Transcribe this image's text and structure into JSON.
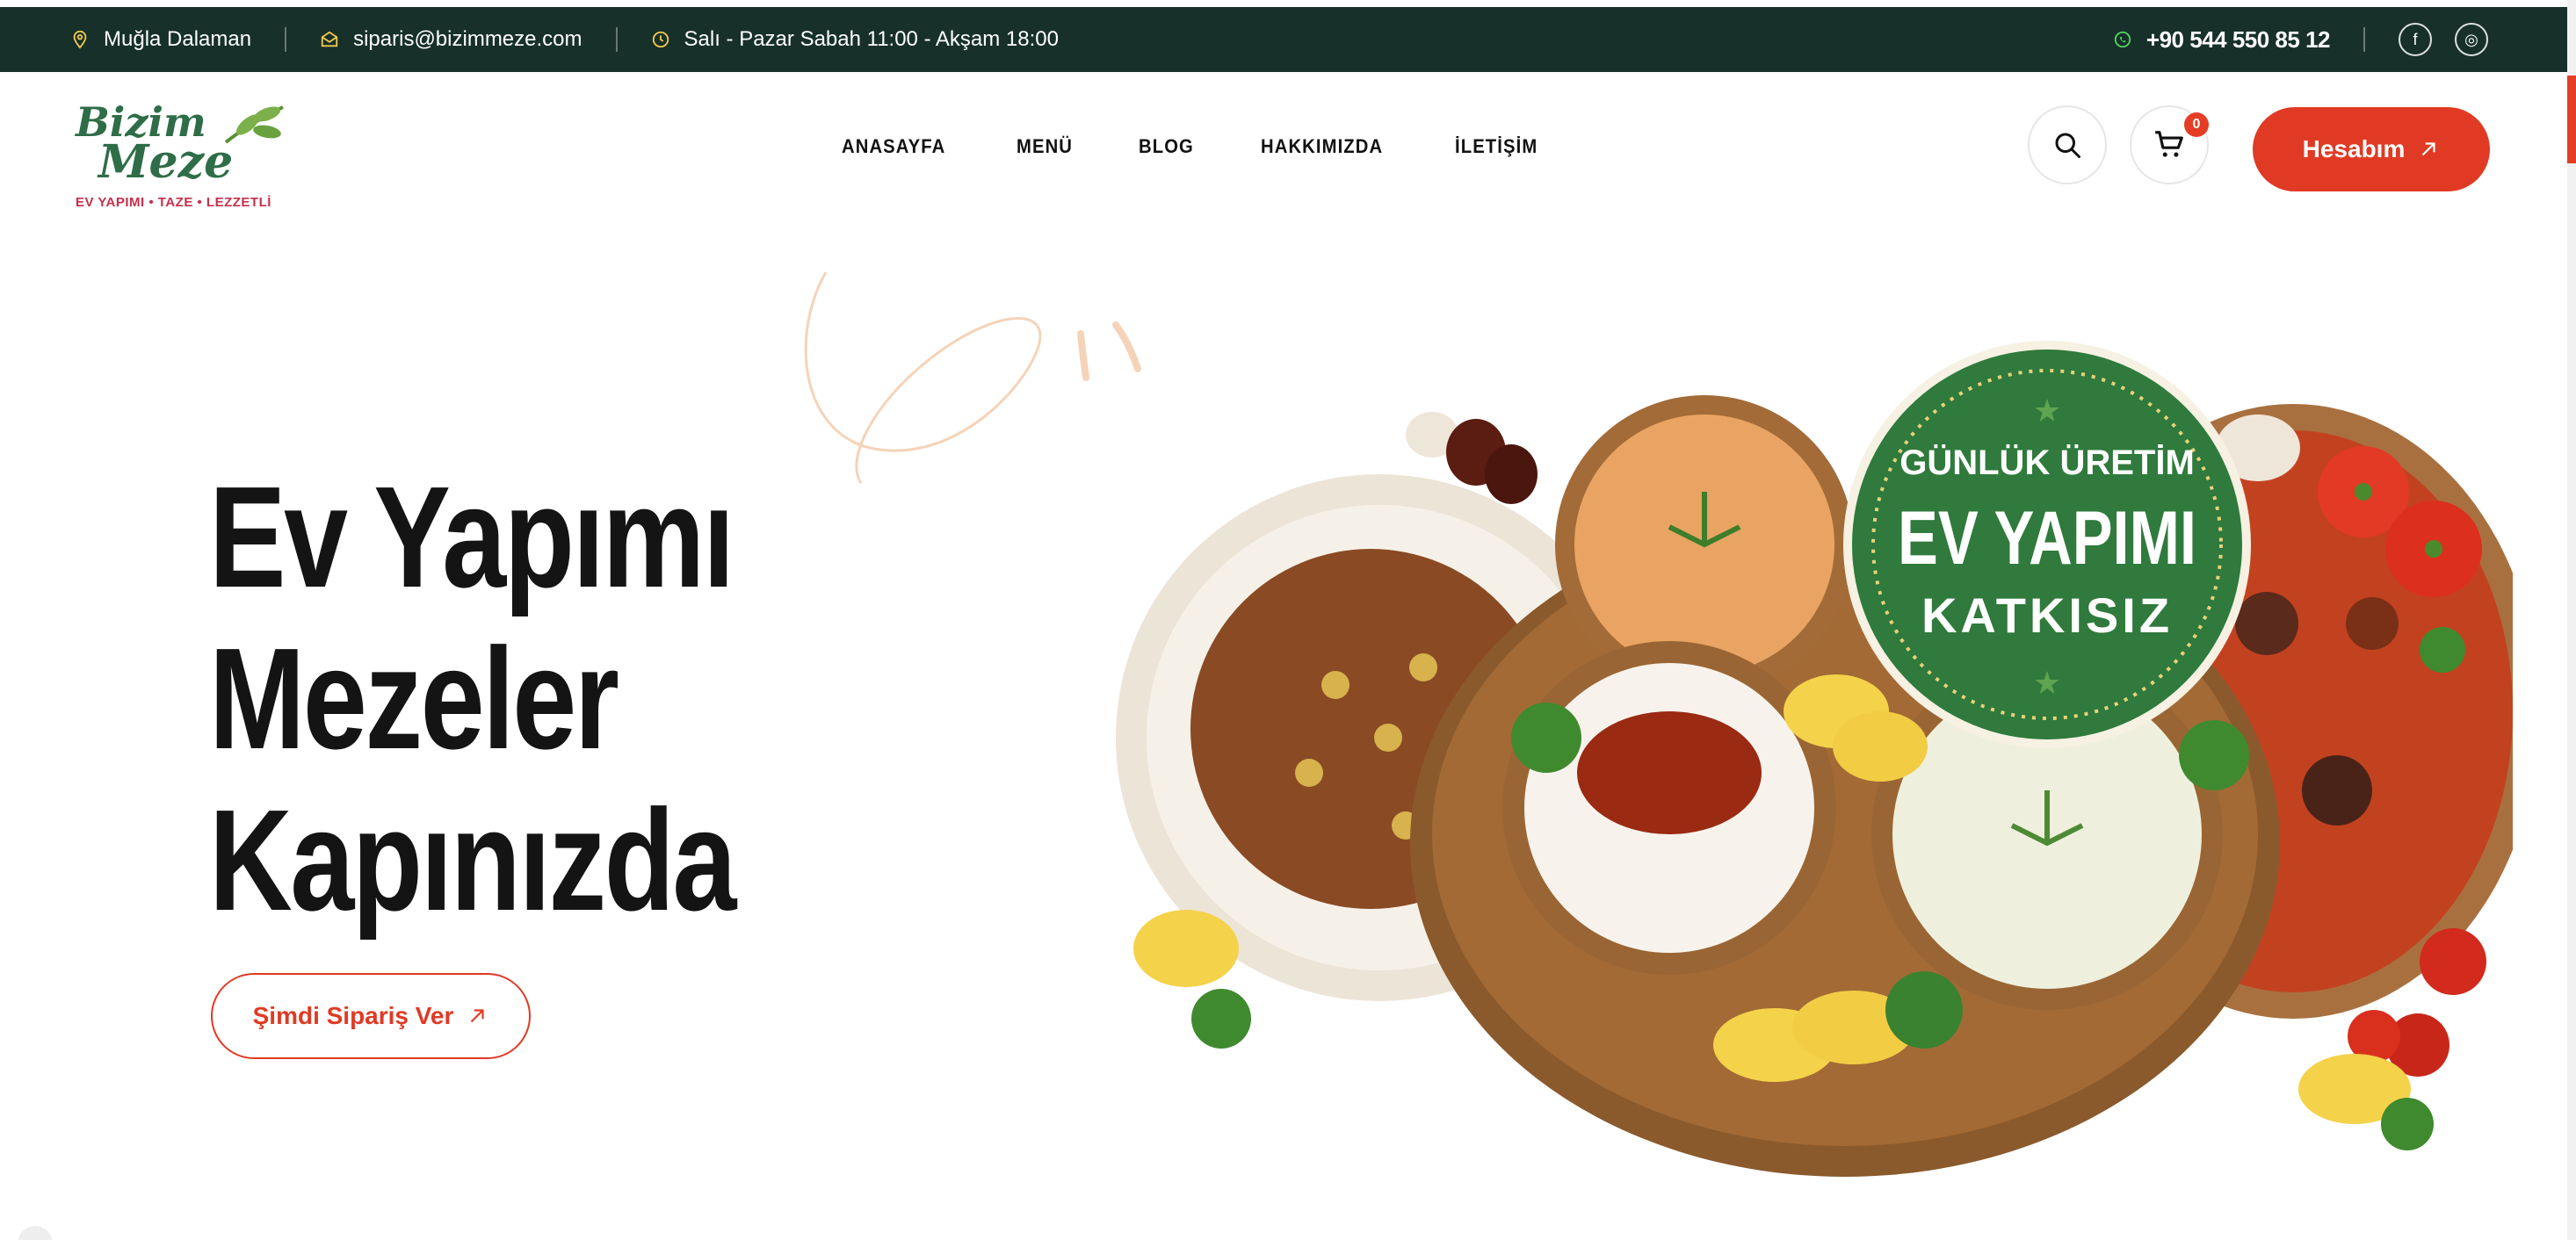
{
  "topbar": {
    "location": "Muğla Dalaman",
    "email": "siparis@bizimmeze.com",
    "hours": "Salı - Pazar Sabah 11:00 - Akşam 18:00",
    "phone": "+90 544 550 85 12",
    "social": [
      "f",
      "◎"
    ]
  },
  "brand": {
    "logo_word1": "Bizim",
    "logo_word2": "Meze",
    "tagline": "EV YAPIMI • TAZE • LEZZETLİ"
  },
  "nav": {
    "items": [
      "ANASAYFA",
      "MENÜ",
      "BLOG",
      "HAKKIMIZDA",
      "İLETİŞİM"
    ]
  },
  "header": {
    "cart_count": "0",
    "account_label": "Hesabım"
  },
  "hero": {
    "title_line1": "Ev Yapımı",
    "title_line2": "Mezeler",
    "title_line3": "Kapınızda",
    "cta_label": "Şimdi Sipariş Ver",
    "badge_top": "GÜNLÜK ÜRETİM",
    "badge_main": "EV YAPIMI",
    "badge_bottom": "KATKISIZ"
  },
  "colors": {
    "topbar_bg": "#17302a",
    "accent": "#e03a24",
    "brand_green": "#2e6d47",
    "badge_green": "#2f7a3c"
  }
}
